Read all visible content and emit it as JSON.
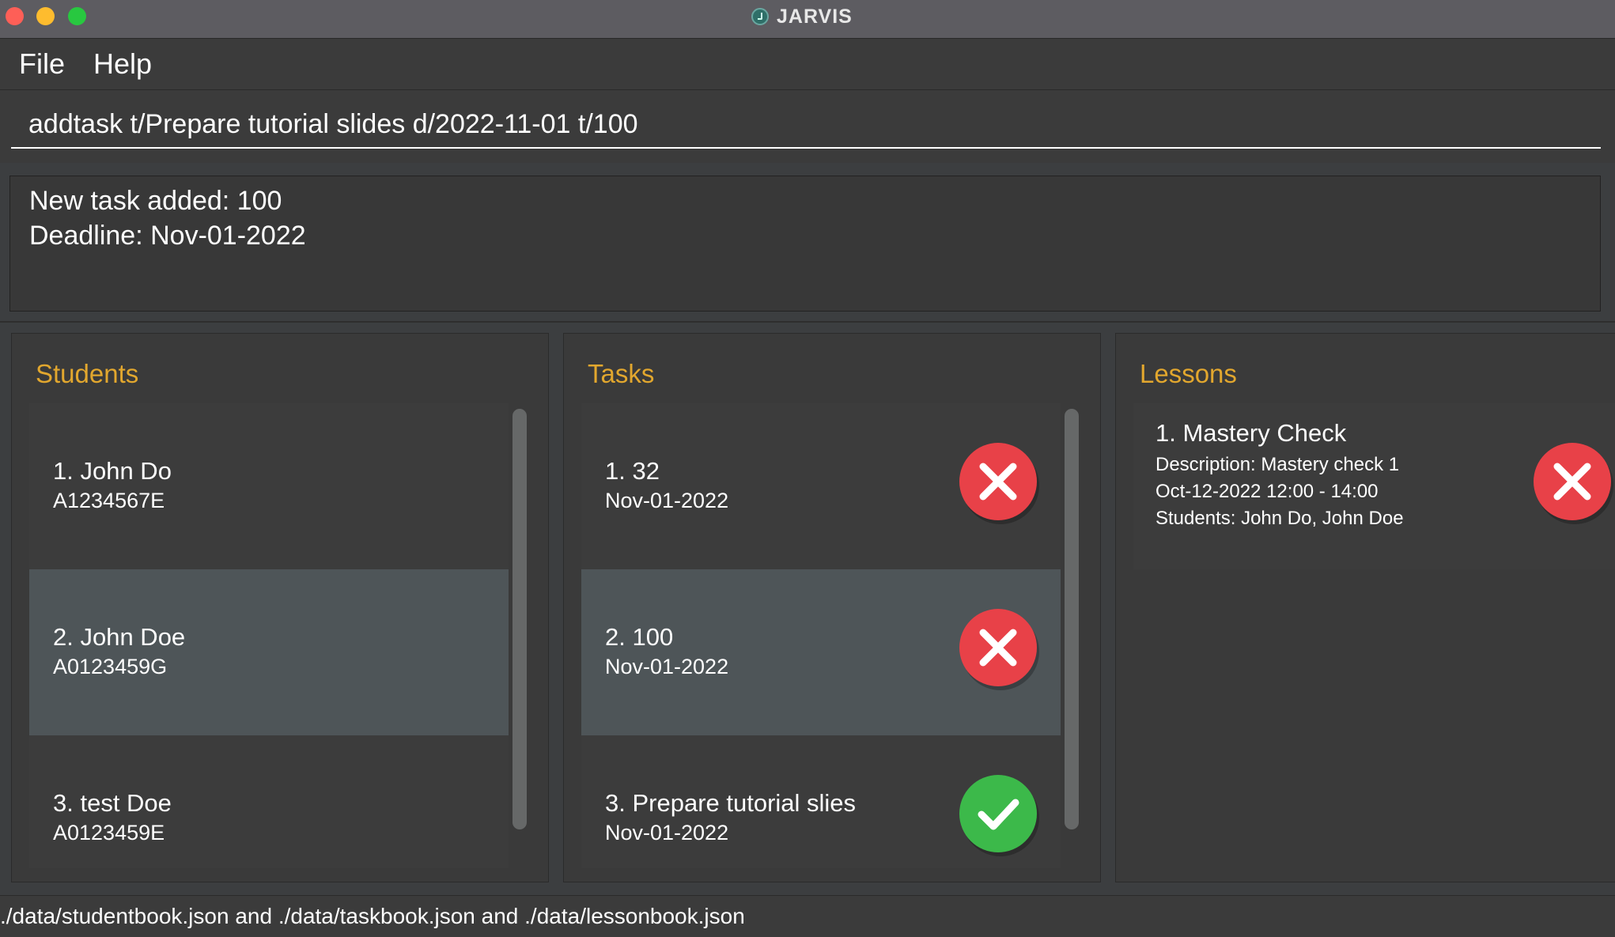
{
  "window": {
    "title": "JARVIS"
  },
  "menu": {
    "items": [
      "File",
      "Help"
    ]
  },
  "command": {
    "value": "addtask t/Prepare tutorial slides d/2022-11-01 t/100"
  },
  "result": {
    "lines": [
      "New task added: 100",
      "Deadline: Nov-01-2022"
    ]
  },
  "students": {
    "title": "Students",
    "items": [
      {
        "name": "1.  John Do",
        "id": "A1234567E"
      },
      {
        "name": "2.  John Doe",
        "id": "A0123459G"
      },
      {
        "name": "3.  test Doe",
        "id": "A0123459E"
      }
    ]
  },
  "tasks": {
    "title": "Tasks",
    "items": [
      {
        "name": "1.  32",
        "deadline": "Nov-01-2022",
        "status": "not-done",
        "status_icon": "cross-icon"
      },
      {
        "name": "2.  100",
        "deadline": "Nov-01-2022",
        "status": "not-done",
        "status_icon": "cross-icon"
      },
      {
        "name": "3.  Prepare tutorial slies",
        "deadline": "Nov-01-2022",
        "status": "done",
        "status_icon": "check-icon"
      }
    ]
  },
  "lessons": {
    "title": "Lessons",
    "items": [
      {
        "name": "1.  Mastery Check",
        "description": "Description: Mastery check 1",
        "time": "Oct-12-2022 12:00 - 14:00",
        "students": "Students: John Do, John Doe",
        "status": "not-done",
        "status_icon": "cross-icon"
      }
    ]
  },
  "statusbar": {
    "text": "./data/studentbook.json and ./data/taskbook.json and ./data/lessonbook.json"
  },
  "colors": {
    "accent": "#e2a72e",
    "status_red": "#e84148",
    "status_green": "#3cb94a",
    "selected_row": "#4e5558"
  }
}
